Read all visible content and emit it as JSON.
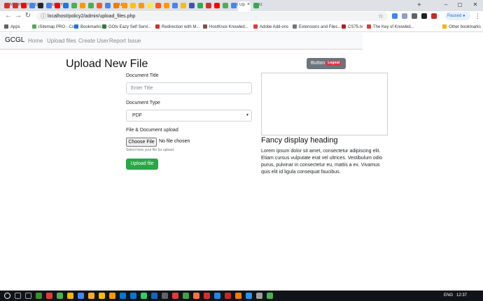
{
  "browser": {
    "tabs": [
      {
        "label": "M",
        "color": "#d93025"
      },
      {
        "label": "M",
        "color": "#d93025"
      },
      {
        "label": "Y",
        "color": "#ff0000"
      },
      {
        "label": "G",
        "color": "#4285f4"
      },
      {
        "label": "",
        "color": "#24292e"
      },
      {
        "label": "G",
        "color": "#4285f4"
      },
      {
        "label": "Y",
        "color": "#ff0000"
      },
      {
        "label": "",
        "color": "#1877f2"
      },
      {
        "label": "",
        "color": "#4caf50"
      },
      {
        "label": "",
        "color": "#ff9800"
      },
      {
        "label": "",
        "color": "#4caf50"
      },
      {
        "label": "",
        "color": "#ff5722"
      },
      {
        "label": "",
        "color": "#4285f4"
      },
      {
        "label": "U",
        "color": "#f57c00"
      },
      {
        "label": "",
        "color": "#ff9800"
      },
      {
        "label": "",
        "color": "#ffc107"
      },
      {
        "label": "",
        "color": "#ff9800"
      },
      {
        "label": "",
        "color": "#ffeb3b"
      },
      {
        "label": "",
        "color": "#ff5722"
      },
      {
        "label": "",
        "color": "#ff9800"
      },
      {
        "label": "",
        "color": "#4285f4"
      },
      {
        "label": "",
        "color": "#fbbc04"
      },
      {
        "label": "",
        "color": "#3f51b5"
      },
      {
        "label": "",
        "color": "#34a853"
      },
      {
        "label": "",
        "color": "#d32f2f"
      },
      {
        "label": "",
        "color": "#ff0000"
      },
      {
        "label": "",
        "color": "#4caf50"
      },
      {
        "label": "G",
        "color": "#4285f4"
      },
      {
        "label": "G",
        "color": "#34a853"
      }
    ],
    "active_tab": {
      "label": "Up"
    },
    "url": "localhost/policy2/admin/upload_files.php",
    "paused_label": "Paused",
    "bookmarks": [
      {
        "label": "Apps",
        "color": "#5f6368"
      },
      {
        "label": "iSitemap PRO - Co...",
        "color": "#4caf50"
      },
      {
        "label": "Bookmarks",
        "color": "#1a73e8"
      },
      {
        "label": "GOtv Eazy Self Servi...",
        "color": "#2e7d32"
      },
      {
        "label": "Redirection with M...",
        "color": "#d32f2f"
      },
      {
        "label": "HostKnox Knowled...",
        "color": "#795548"
      },
      {
        "label": "Adobe Add-ons",
        "color": "#e53935"
      },
      {
        "label": "Extensions and Files...",
        "color": "#757575"
      },
      {
        "label": "CS75.tv",
        "color": "#b71c1c"
      },
      {
        "label": "The Key of Knowled...",
        "color": "#e53935"
      },
      {
        "label": "Other bookmarks",
        "color": "#f4b400"
      }
    ]
  },
  "navbar": {
    "brand": "GCGL",
    "links": [
      "Home",
      "Upload files",
      "Create User",
      "Report Issue"
    ]
  },
  "form": {
    "title": "Upload New File",
    "doc_title_label": "Document Title",
    "doc_title_placeholder": "Enter Title",
    "doc_type_label": "Document Type",
    "doc_type_value": "PDF",
    "file_label": "File & Document upload",
    "choose_file": "Choose File",
    "no_file": "No file chosen",
    "file_help": "Select here your file for upload.",
    "submit": "Upload file"
  },
  "side": {
    "button_label": "Button",
    "button_badge": "Logout",
    "heading": "Fancy display heading",
    "paragraph": "Lorem ipsum dolor sit amet, consectetur adipiscing elit. Etiam cursus vulputate erat vel ultrices. Vestibulum odio purus, pulvinar in consectetur eu, mattis a ex. Vivamus quis elit id ligula consequat faucibus."
  },
  "taskbar": {
    "lang": "ENG",
    "time": "12:37",
    "colors": {
      "accent": "#101418"
    }
  }
}
